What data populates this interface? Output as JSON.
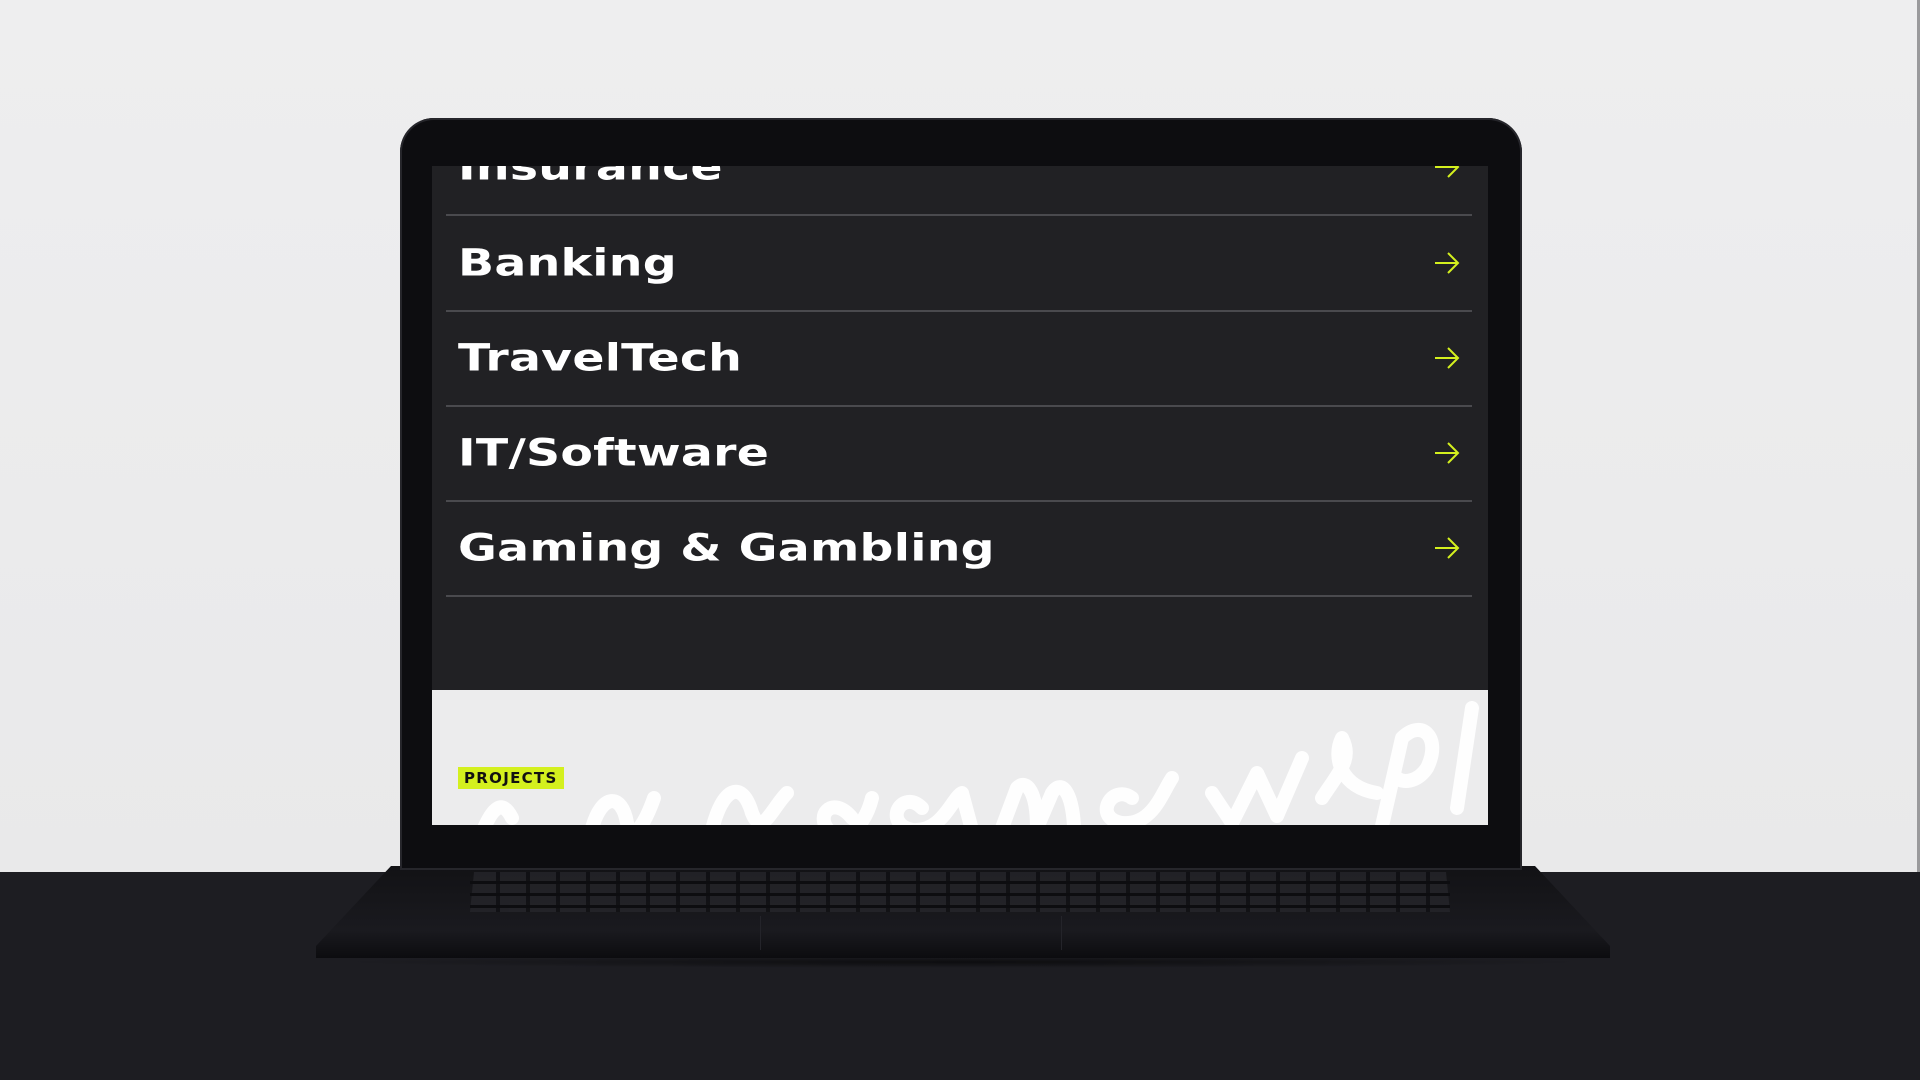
{
  "industries": [
    {
      "label": "Insurance",
      "icon": "arrow-right-icon"
    },
    {
      "label": "Banking",
      "icon": "arrow-right-icon"
    },
    {
      "label": "TravelTech",
      "icon": "arrow-right-icon"
    },
    {
      "label": "IT/Software",
      "icon": "arrow-right-icon"
    },
    {
      "label": "Gaming & Gambling",
      "icon": "arrow-right-icon"
    }
  ],
  "projects": {
    "badge_label": "PROJECTS"
  },
  "colors": {
    "accent": "#d4f01e",
    "dark_background": "#212124",
    "light_background": "#ececed",
    "row_text": "#ffffff",
    "divider": "#4a4a4e"
  }
}
